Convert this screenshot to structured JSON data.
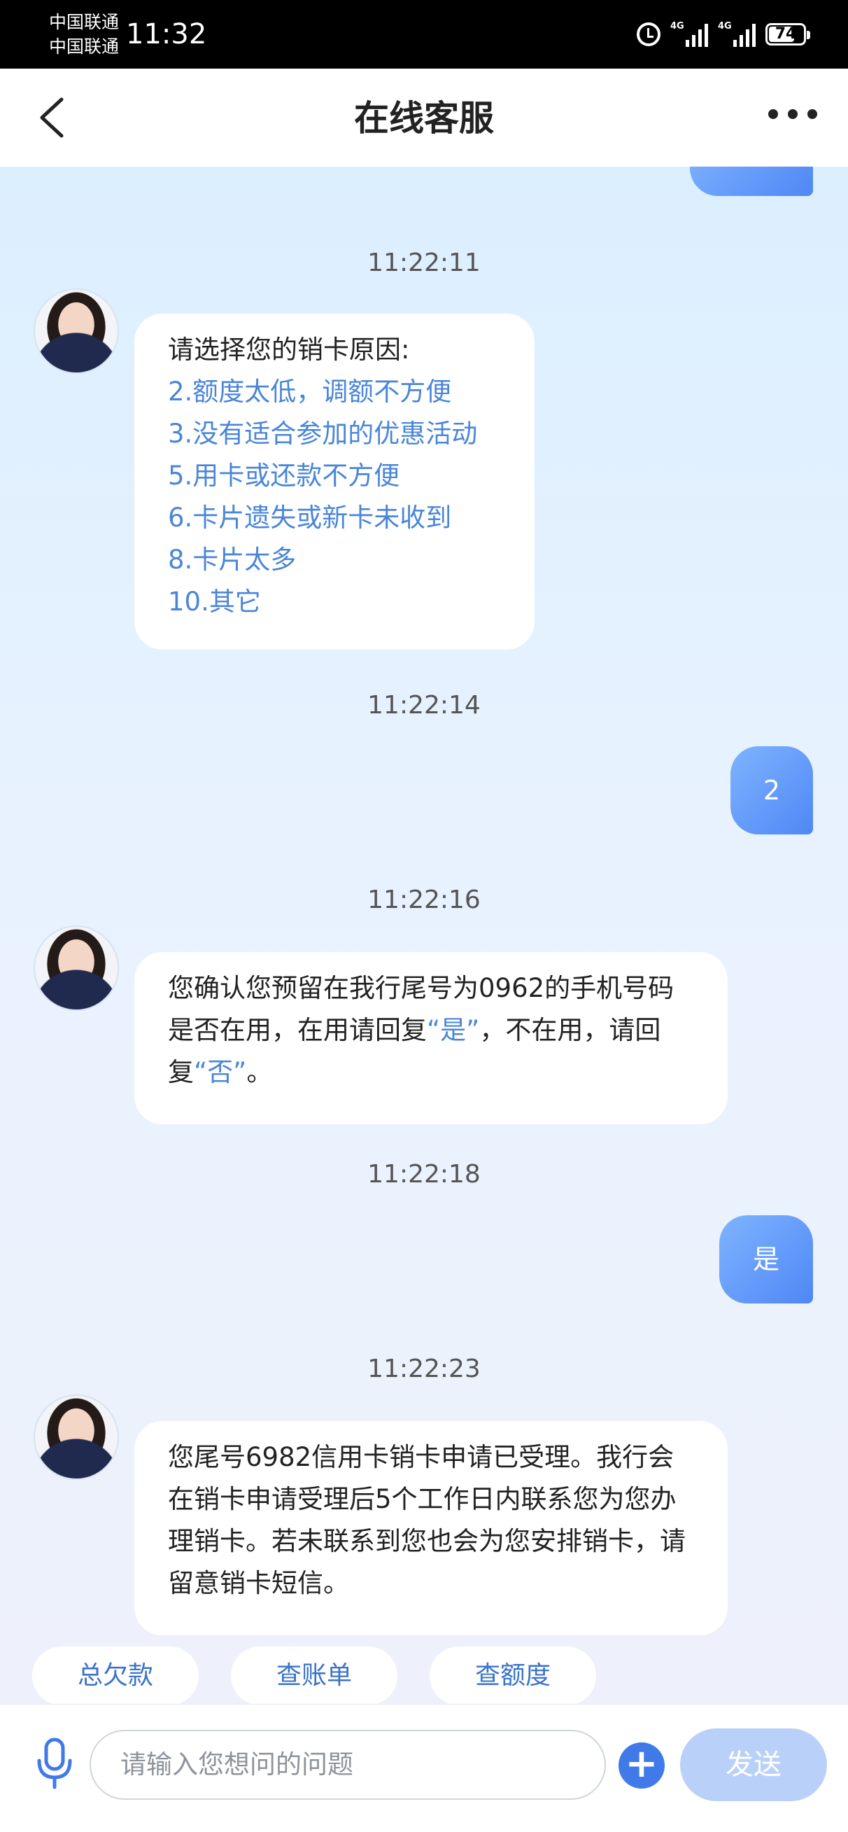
{
  "status_bar": {
    "carrier_1": "中国联通",
    "carrier_2": "中国联通",
    "time": "11:32",
    "network_1": "4G",
    "network_2": "4G",
    "battery": "74"
  },
  "header": {
    "title": "在线客服",
    "back_icon": "chevron-left-icon",
    "more_icon": "more-dots-icon"
  },
  "messages": [
    {
      "timestamp": "11:22:11",
      "from": "agent",
      "prompt": "请选择您的销卡原因:",
      "options": [
        "2.额度太低，调额不方便",
        "3.没有适合参加的优惠活动",
        "5.用卡或还款不方便",
        "6.卡片遗失或新卡未收到",
        "8.卡片太多",
        "10.其它"
      ]
    },
    {
      "timestamp": "11:22:14",
      "from": "user",
      "text": "2"
    },
    {
      "timestamp": "11:22:16",
      "from": "agent",
      "parts": [
        "您确认您预留在我行尾号为0962的手机号码是否在用，在用请回复",
        "“是”",
        "，不在用，请回复",
        "“否”",
        "。"
      ]
    },
    {
      "timestamp": "11:22:18",
      "from": "user",
      "text": "是"
    },
    {
      "timestamp": "11:22:23",
      "from": "agent",
      "text": "您尾号6982信用卡销卡申请已受理。我行会在销卡申请受理后5个工作日内联系您为您办理销卡。若未联系到您也会为您安排销卡，请留意销卡短信。"
    }
  ],
  "quick_replies": [
    "总欠款",
    "查账单",
    "查额度"
  ],
  "input_bar": {
    "placeholder": "请输入您想问的问题",
    "send_label": "发送",
    "mic_icon": "microphone-icon",
    "plus_icon": "plus-circle-icon"
  },
  "colors": {
    "accent": "#4f87f5",
    "link": "#4a86d8",
    "send_disabled": "#b9d1f9"
  }
}
